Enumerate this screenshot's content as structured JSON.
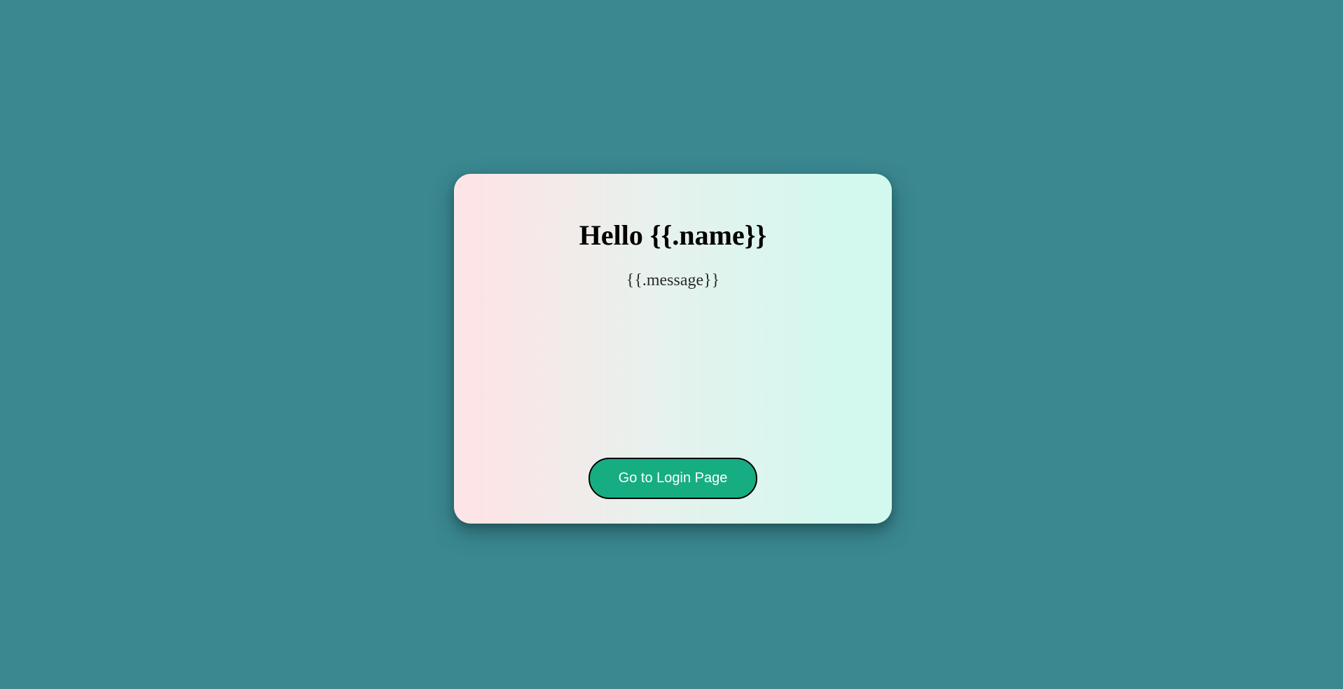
{
  "card": {
    "title": "Hello {{.name}}",
    "message": "{{.message}}",
    "button_label": "Go to Login Page"
  },
  "colors": {
    "page_background": "#3b8891",
    "button_background": "#17ad83",
    "gradient_left": "#fde4e6",
    "gradient_right": "#d3f8ee"
  }
}
